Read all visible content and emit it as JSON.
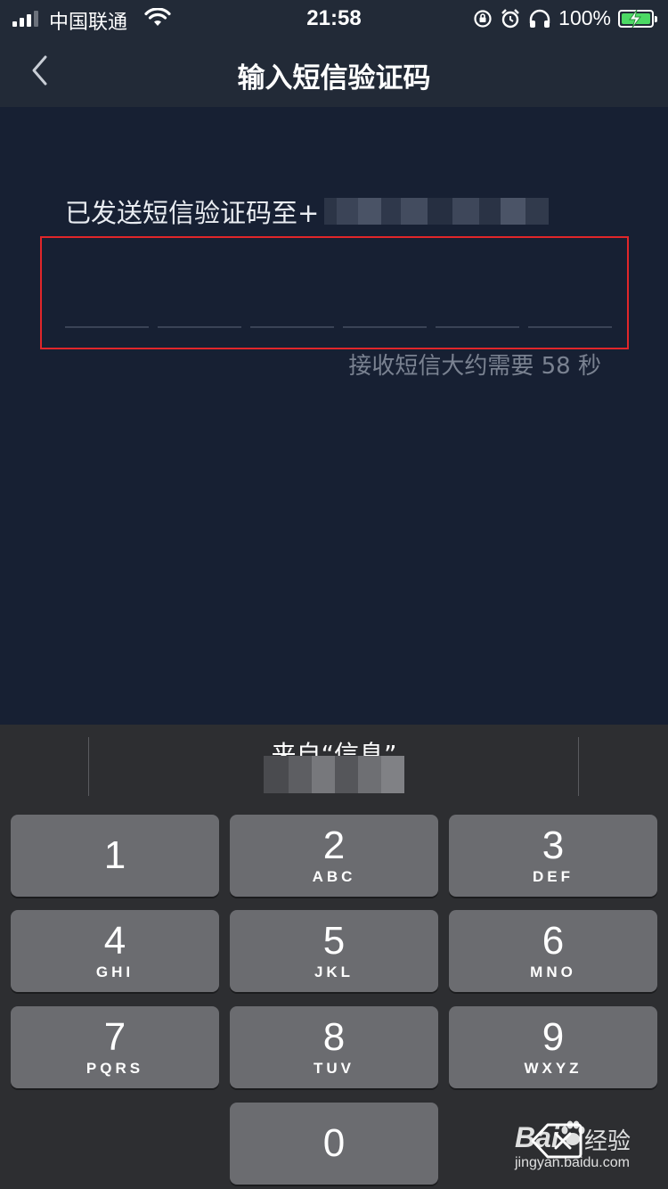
{
  "status_bar": {
    "carrier": "中国联通",
    "time": "21:58",
    "battery_percent": "100%",
    "battery_level": 1.0
  },
  "nav": {
    "title": "输入短信验证码",
    "back_icon": "chevron-left-icon"
  },
  "content": {
    "sent_to_label": "已发送短信验证码至+",
    "code_digit_count": 6,
    "countdown": "接收短信大约需要 58 秒"
  },
  "keyboard": {
    "suggestion_label": "来自“信息”",
    "keys": [
      {
        "num": "1",
        "letters": ""
      },
      {
        "num": "2",
        "letters": "ABC"
      },
      {
        "num": "3",
        "letters": "DEF"
      },
      {
        "num": "4",
        "letters": "GHI"
      },
      {
        "num": "5",
        "letters": "JKL"
      },
      {
        "num": "6",
        "letters": "MNO"
      },
      {
        "num": "7",
        "letters": "PQRS"
      },
      {
        "num": "8",
        "letters": "TUV"
      },
      {
        "num": "9",
        "letters": "WXYZ"
      },
      {
        "num": "0",
        "letters": ""
      }
    ],
    "delete_icon": "backspace-icon"
  },
  "watermark": {
    "logo": "Bai",
    "brand": "经验",
    "url": "jingyan.baidu.com"
  },
  "colors": {
    "background": "#172033",
    "nav_background": "#222a37",
    "highlight_border": "#e1262a",
    "keyboard_background": "#2d2e31",
    "key_background": "#6b6c70",
    "battery_green": "#4cd964"
  }
}
